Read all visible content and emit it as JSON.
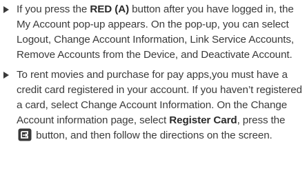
{
  "bullets": [
    {
      "t1": "If you press the ",
      "b1": "RED (A)",
      "t2": " button after you have logged in, the My Account pop-up appears. On the pop-up, you can select Logout, Change Account Information, Link Service Accounts, Remove Accounts from the Device, and Deactivate Account."
    },
    {
      "t1": "To rent movies and purchase for pay apps,you must have a credit card registered in your account. If you haven’t registered a card, select Change Account Information. On the Change Account information page, select ",
      "b1": "Register Card",
      "t2": ", press the ",
      "icon": "enter-button-icon",
      "t3": " button, and then follow the directions on the screen."
    }
  ],
  "colors": {
    "text": "#3a3a3a",
    "icon_bg": "#3a3a3a",
    "icon_fg": "#ffffff"
  }
}
